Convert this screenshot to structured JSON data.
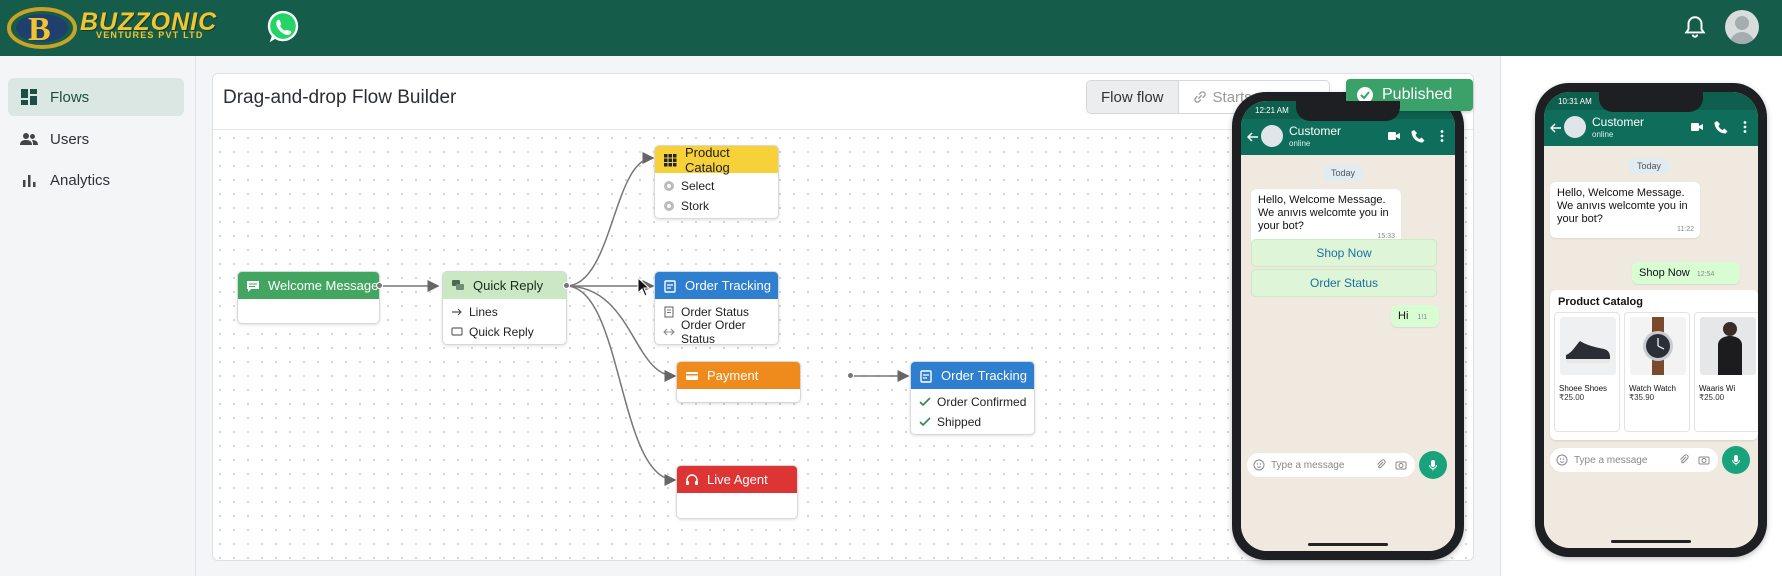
{
  "header": {
    "brand_name": "BUZZONIC",
    "brand_sub": "VENTURES PVT LTD"
  },
  "sidebar": {
    "items": [
      {
        "label": "Flows",
        "icon": "dashboard-icon",
        "active": true
      },
      {
        "label": "Users",
        "icon": "users-icon",
        "active": false
      },
      {
        "label": "Analytics",
        "icon": "bar-chart-icon",
        "active": false
      }
    ]
  },
  "builder": {
    "title": "Drag-and-drop Flow Builder",
    "segment_active": "Flow flow",
    "segment_inactive": "Starts",
    "published_label": "Published",
    "nodes": {
      "welcome": {
        "title": "Welcome Message"
      },
      "quick_reply": {
        "title": "Quick Reply",
        "rows": [
          "Lines",
          "Quick Reply"
        ]
      },
      "product_catalog": {
        "title": "Product Catalog",
        "rows": [
          "Select",
          "Stork"
        ]
      },
      "order_tracking_1": {
        "title": "Order Tracking",
        "rows": [
          "Order Status",
          "Order Order Status"
        ]
      },
      "payment": {
        "title": "Payment"
      },
      "order_tracking_2": {
        "title": "Order Tracking",
        "rows": [
          "Order Confirmed",
          "Shipped"
        ]
      },
      "live_agent": {
        "title": "Live Agent"
      }
    }
  },
  "phone1": {
    "time": "12:21 AM",
    "contact": "Customer",
    "status": "online",
    "date": "Today",
    "incoming": [
      "Hello, Welcome Message.",
      "We anıvıs welcomte you in",
      "your bot?"
    ],
    "incoming_time": "15:33",
    "buttons": [
      "Shop Now",
      "Order Status"
    ],
    "outgoing": "Hi",
    "outgoing_time": "1!1",
    "compose_placeholder": "Type a message"
  },
  "phone2": {
    "time": "10:31 AM",
    "contact": "Customer",
    "status": "online",
    "date": "Today",
    "incoming": [
      "Hello, Welcome Message.",
      "We anıvıs welcomte you in",
      "your bot?"
    ],
    "incoming_time": "11:22",
    "outgoing": "Shop Now",
    "outgoing_time": "12:54",
    "catalog_title": "Product Catalog",
    "products": [
      {
        "name": "Shoee Shoes",
        "price": "₹25.00"
      },
      {
        "name": "Watch Watch",
        "price": "₹35.90"
      },
      {
        "name": "Waaris Wi",
        "price": "₹25.00"
      }
    ],
    "compose_placeholder": "Type a message"
  },
  "colors": {
    "header": "#155c4a",
    "brand": "#f2c530",
    "published": "#3aa169"
  }
}
